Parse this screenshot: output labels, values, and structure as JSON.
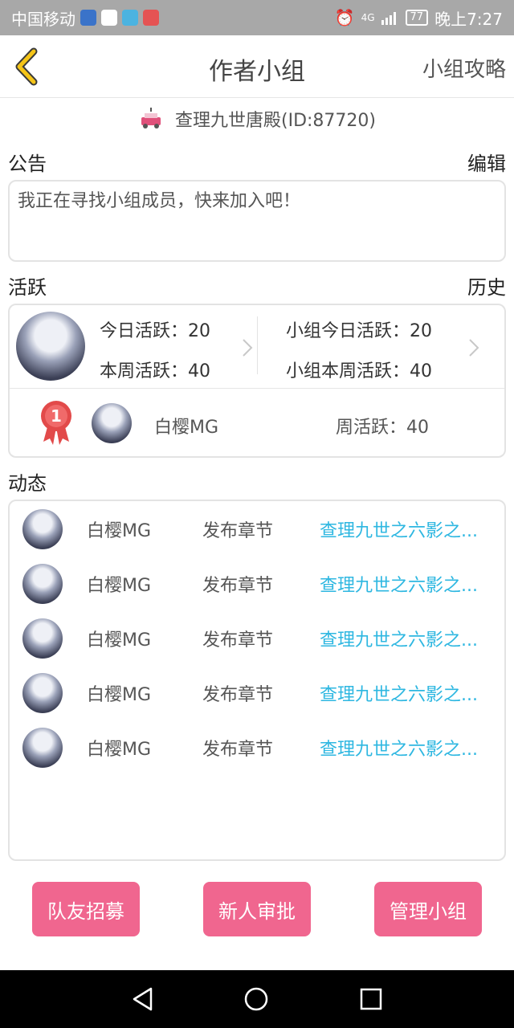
{
  "status_bar": {
    "carrier": "中国移动",
    "network": "4G",
    "battery": "77",
    "time": "晚上7:27"
  },
  "nav": {
    "title": "作者小组",
    "right_link": "小组攻略"
  },
  "author": {
    "name": "查理九世唐殿(ID:87720)"
  },
  "notice": {
    "title": "公告",
    "edit": "编辑",
    "text": "我正在寻找小组成员，快来加入吧！"
  },
  "activity": {
    "title": "活跃",
    "history": "历史",
    "today": "今日活跃：20",
    "week": "本周活跃：40",
    "group_today": "小组今日活跃：20",
    "group_week": "小组本周活跃：40",
    "rank": "1",
    "top_user": "白樱MG",
    "top_user_week": "周活跃：40"
  },
  "feed": {
    "title": "动态",
    "items": [
      {
        "user": "白樱MG",
        "action": "发布章节",
        "target": "查理九世之六影之..."
      },
      {
        "user": "白樱MG",
        "action": "发布章节",
        "target": "查理九世之六影之..."
      },
      {
        "user": "白樱MG",
        "action": "发布章节",
        "target": "查理九世之六影之..."
      },
      {
        "user": "白樱MG",
        "action": "发布章节",
        "target": "查理九世之六影之..."
      },
      {
        "user": "白樱MG",
        "action": "发布章节",
        "target": "查理九世之六影之..."
      }
    ]
  },
  "buttons": {
    "recruit": "队友招募",
    "approve": "新人审批",
    "manage": "管理小组"
  },
  "colors": {
    "accent_pink": "#f0668f",
    "link_blue": "#2eb7e1",
    "back_yellow": "#f5c518"
  }
}
